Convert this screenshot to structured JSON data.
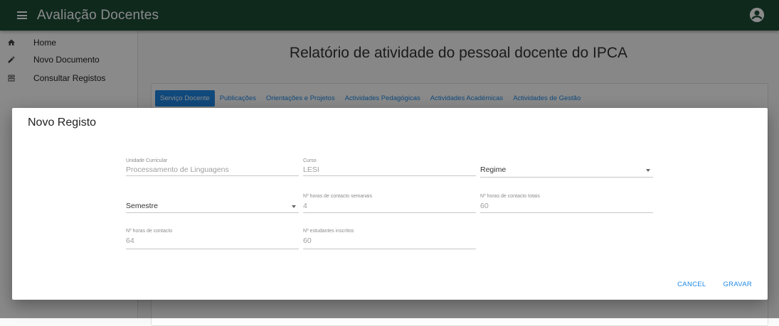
{
  "appbar": {
    "title": "Avaliação Docentes",
    "menu_icon": "hamburger-menu-icon",
    "account_icon": "account-circle-icon"
  },
  "sidebar": {
    "items": [
      {
        "label": "Home",
        "icon": "home-icon"
      },
      {
        "label": "Novo Documento",
        "icon": "pencil-icon"
      },
      {
        "label": "Consultar Registos",
        "icon": "archive-icon"
      }
    ]
  },
  "main": {
    "page_title": "Relatório de atividade do pessoal docente do IPCA",
    "tabs": [
      {
        "label": "Serviço Docente",
        "active": true
      },
      {
        "label": "Publicações"
      },
      {
        "label": "Orientações e Projetos"
      },
      {
        "label": "Actividades Pedagógicas"
      },
      {
        "label": "Actividades Académicas"
      },
      {
        "label": "Actividades de Gestão"
      }
    ]
  },
  "dialog": {
    "title": "Novo Registo",
    "fields": {
      "unidade_curricular": {
        "label": "Unidade Curricular",
        "value": "Processamento de Linguagens"
      },
      "curso": {
        "label": "Curso",
        "value": "LESI"
      },
      "regime": {
        "label": "",
        "value": "Regime"
      },
      "semestre": {
        "label": "",
        "value": "Semestre"
      },
      "horas_semanais": {
        "label": "Nº horas de contacto semanais",
        "value": "4"
      },
      "horas_totais": {
        "label": "Nº horas de contacto totais",
        "value": "60"
      },
      "horas_contacto": {
        "label": "Nº horas de contacto",
        "value": "64"
      },
      "estudantes": {
        "label": "Nº estudantes inscritos",
        "value": "60"
      }
    },
    "actions": {
      "cancel": "CANCEL",
      "save": "GRAVAR"
    }
  },
  "colors": {
    "appbar": "#1d4d36",
    "accent": "#1e88e5"
  }
}
